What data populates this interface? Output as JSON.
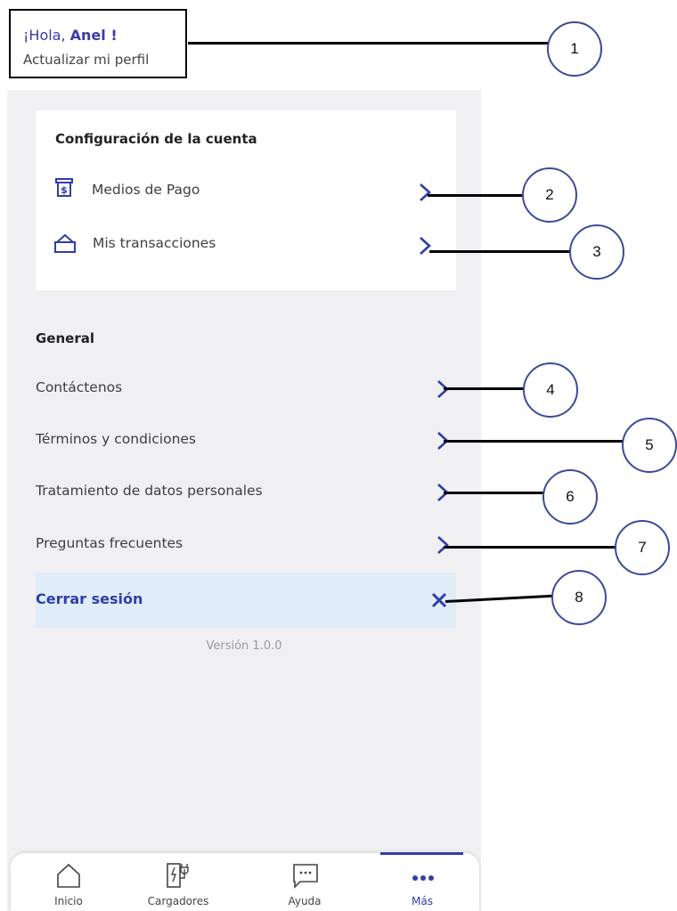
{
  "header": {
    "greeting_prefix": "¡Hola, ",
    "user_name": "Anel !",
    "update_profile": "Actualizar mi perfil"
  },
  "account": {
    "title": "Configuración de la cuenta",
    "items": [
      {
        "label": "Medios de Pago",
        "icon": "payment-icon"
      },
      {
        "label": "Mis transacciones",
        "icon": "transactions-icon"
      }
    ]
  },
  "general": {
    "title": "General",
    "items": [
      {
        "label": "Contáctenos"
      },
      {
        "label": "Términos y condiciones"
      },
      {
        "label": "Tratamiento de datos personales"
      },
      {
        "label": "Preguntas frecuentes"
      }
    ]
  },
  "logout": {
    "label": "Cerrar sesión",
    "icon": "close-icon"
  },
  "version": "Versión 1.0.0",
  "nav": [
    {
      "label": "Inicio",
      "icon": "home-icon"
    },
    {
      "label": "Cargadores",
      "icon": "charger-icon"
    },
    {
      "label": "Ayuda",
      "icon": "chat-icon"
    },
    {
      "label": "Más",
      "icon": "more-icon",
      "active": true
    }
  ],
  "annotations": [
    "1",
    "2",
    "3",
    "4",
    "5",
    "6",
    "7",
    "8"
  ],
  "colors": {
    "accent": "#2e3fa8",
    "background": "#f0f0f3",
    "logout_bg": "#e0ecf6"
  }
}
